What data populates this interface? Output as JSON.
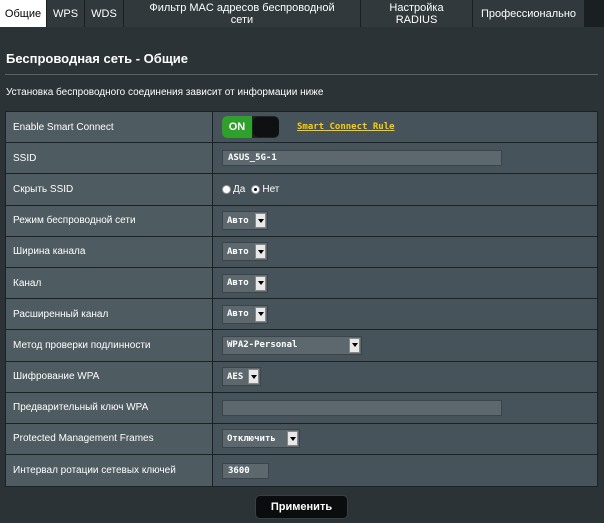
{
  "tabs": [
    {
      "label": "Общие",
      "active": true
    },
    {
      "label": "WPS",
      "active": false
    },
    {
      "label": "WDS",
      "active": false
    },
    {
      "label": "Фильтр MAC адресов беспроводной\nсети",
      "active": false
    },
    {
      "label": "Настройка\nRADIUS",
      "active": false
    },
    {
      "label": "Профессионально",
      "active": false
    }
  ],
  "page": {
    "title": "Беспроводная сеть - Общие",
    "description": "Установка беспроводного соединения зависит от информации ниже"
  },
  "form": {
    "smart_connect": {
      "label": "Enable Smart Connect",
      "toggle_text": "ON",
      "link": "Smart Connect Rule"
    },
    "ssid": {
      "label": "SSID",
      "value": "ASUS_5G-1"
    },
    "hide_ssid": {
      "label": "Скрыть SSID",
      "yes": "Да",
      "no": "Нет",
      "selected": "no"
    },
    "wireless_mode": {
      "label": "Режим беспроводной сети",
      "value": "Авто"
    },
    "channel_width": {
      "label": "Ширина канала",
      "value": "Авто"
    },
    "channel": {
      "label": "Канал",
      "value": "Авто"
    },
    "ext_channel": {
      "label": "Расширенный канал",
      "value": "Авто"
    },
    "auth_method": {
      "label": "Метод проверки подлинности",
      "value": "WPA2-Personal"
    },
    "wpa_encryption": {
      "label": "Шифрование WPA",
      "value": "AES"
    },
    "wpa_psk": {
      "label": "Предварительный ключ WPA",
      "value": ""
    },
    "pmf": {
      "label": "Protected Management Frames",
      "value": "Отключить"
    },
    "key_rotation": {
      "label": "Интервал ротации сетевых ключей",
      "value": "3600"
    }
  },
  "apply_label": "Применить",
  "colors": {
    "accent_green": "#2ea02b",
    "link_yellow": "#ffcc00",
    "panel_bg": "#2b3337"
  }
}
